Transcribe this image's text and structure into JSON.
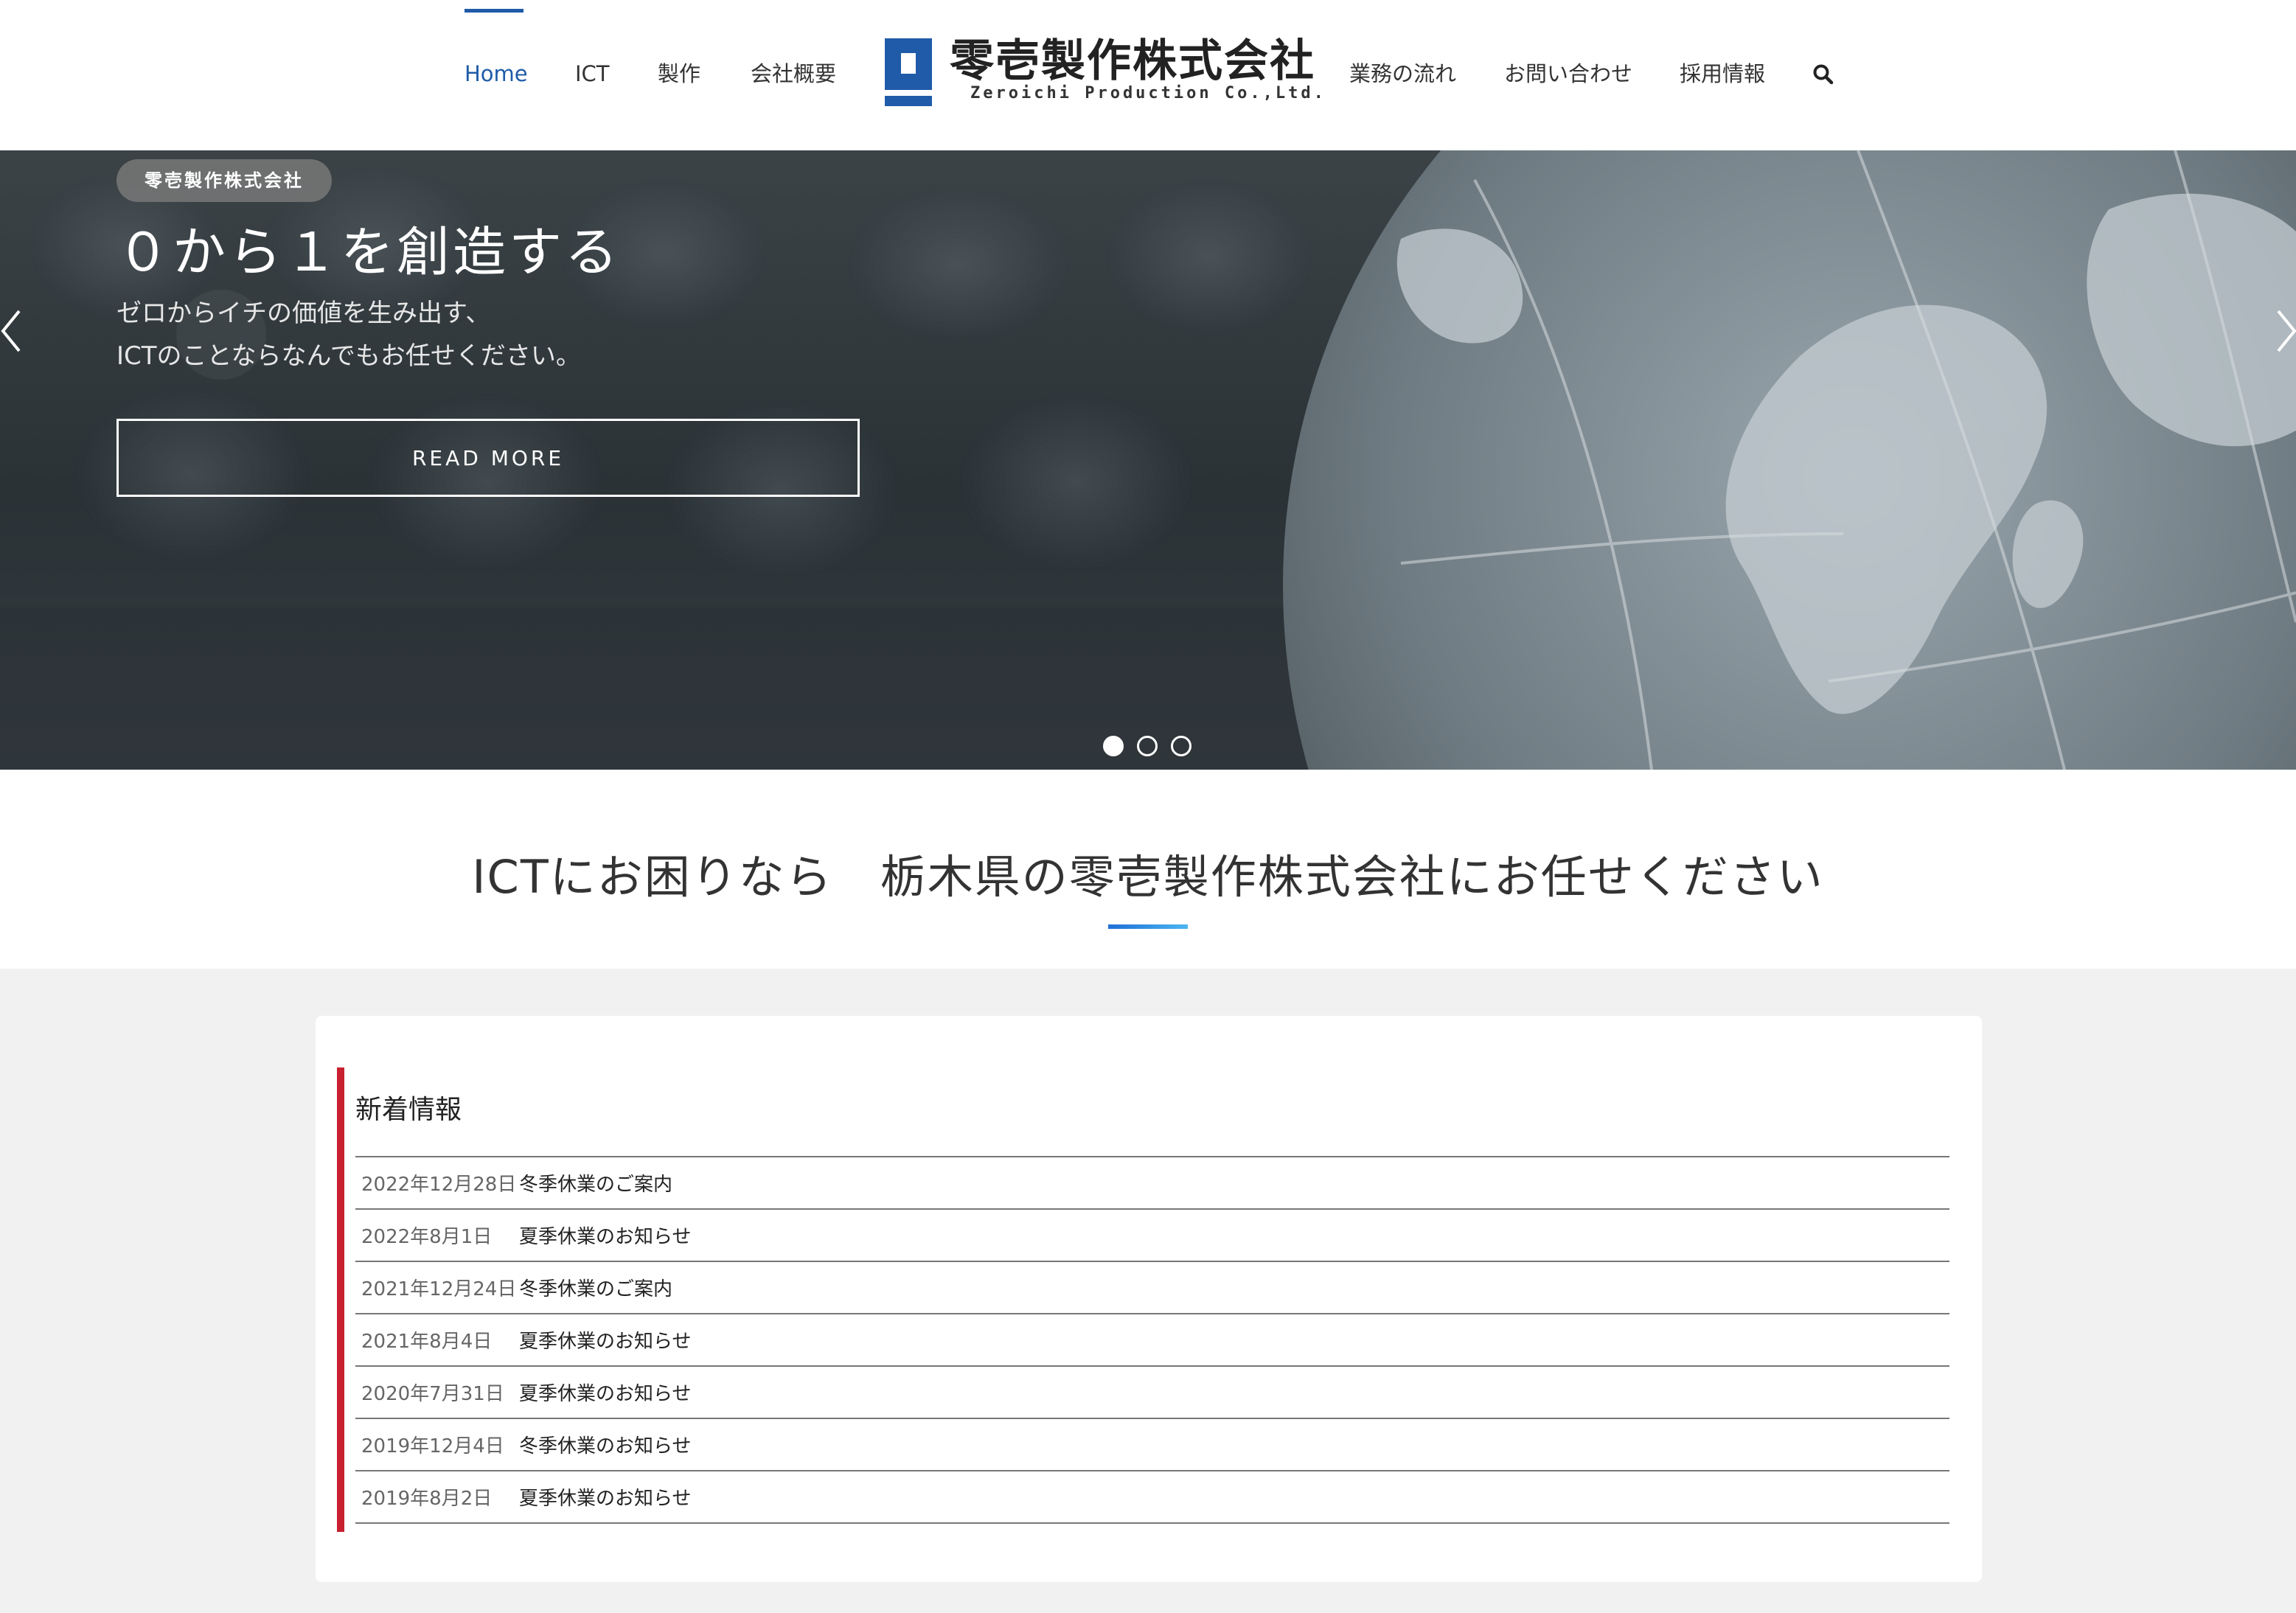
{
  "header": {
    "nav_left": [
      "Home",
      "ICT",
      "製作",
      "会社概要"
    ],
    "nav_right": [
      "業務の流れ",
      "お問い合わせ",
      "採用情報"
    ],
    "active": "Home",
    "logo_name": "零壱製作株式会社",
    "logo_sub": "Zeroichi Production Co.,Ltd.",
    "search_icon": "search-icon"
  },
  "hero": {
    "badge": "零壱製作株式会社",
    "title": "０から１を創造する",
    "text_line1": "ゼロからイチの価値を生み出す、",
    "text_line2": "ICTのことならなんでもお任せください。",
    "button": "READ MORE",
    "slides_total": 3,
    "slide_active": 1
  },
  "headline": "ICTにお困りなら　栃木県の零壱製作株式会社にお任せください",
  "news": {
    "title": "新着情報",
    "items": [
      {
        "date": "2022年12月28日",
        "text": "冬季休業のご案内"
      },
      {
        "date": "2022年8月1日",
        "text": "夏季休業のお知らせ"
      },
      {
        "date": "2021年12月24日",
        "text": "冬季休業のご案内"
      },
      {
        "date": "2021年8月4日",
        "text": "夏季休業のお知らせ"
      },
      {
        "date": "2020年7月31日",
        "text": "夏季休業のお知らせ"
      },
      {
        "date": "2019年12月4日",
        "text": "冬季休業のお知らせ"
      },
      {
        "date": "2019年8月2日",
        "text": "夏季休業のお知らせ"
      }
    ]
  },
  "colors": {
    "brand": "#1f5ba8",
    "accent_red": "#c8202f",
    "headline_bar": "#2a8fe4"
  }
}
